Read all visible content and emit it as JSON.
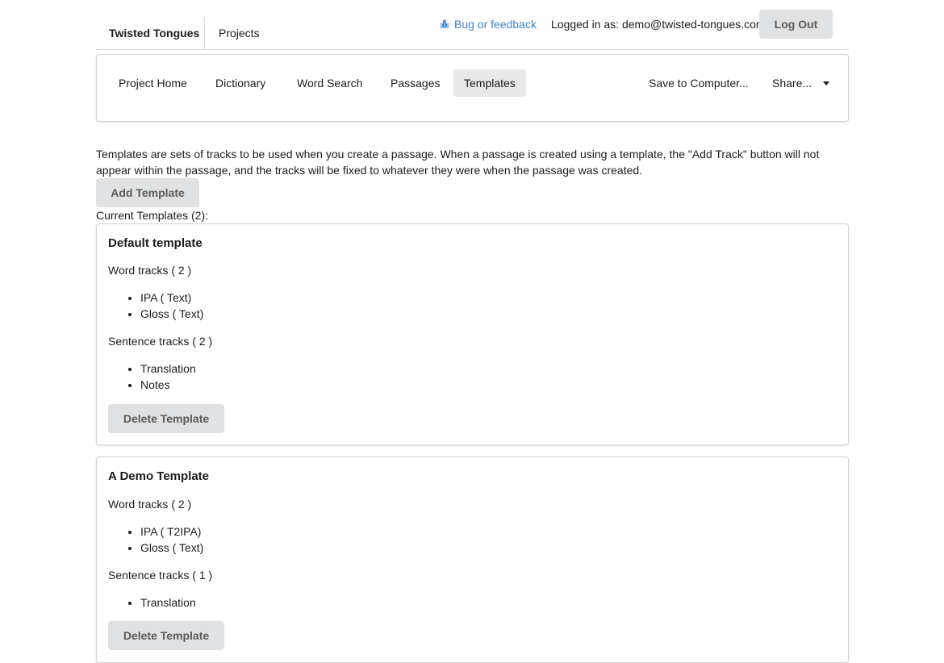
{
  "header": {
    "brand": "Twisted Tongues",
    "projects_label": "Projects",
    "bug_label": "Bug or feedback",
    "logged_in_text": "Logged in as: demo@twisted-tongues.com",
    "logout_label": "Log Out"
  },
  "menu": {
    "items": [
      {
        "label": "Project Home",
        "active": false
      },
      {
        "label": "Dictionary",
        "active": false
      },
      {
        "label": "Word Search",
        "active": false
      },
      {
        "label": "Passages",
        "active": false
      },
      {
        "label": "Templates",
        "active": true
      }
    ],
    "save_label": "Save to Computer...",
    "share_label": "Share..."
  },
  "content": {
    "description": "Templates are sets of tracks to be used when you create a passage. When a passage is created using a template, the \"Add Track\" button will not appear within the passage, and the tracks will be fixed to whatever they were when the passage was created.",
    "add_template_label": "Add Template",
    "current_templates_label": "Current Templates (2):"
  },
  "templates": [
    {
      "name": "Default template",
      "word_tracks_label": "Word tracks ( 2 )",
      "word_tracks": [
        "IPA ( Text)",
        "Gloss ( Text)"
      ],
      "sentence_tracks_label": "Sentence tracks ( 2 )",
      "sentence_tracks": [
        "Translation",
        "Notes"
      ],
      "delete_label": "Delete Template"
    },
    {
      "name": "A Demo Template",
      "word_tracks_label": "Word tracks ( 2 )",
      "word_tracks": [
        "IPA ( T2IPA)",
        "Gloss ( Text)"
      ],
      "sentence_tracks_label": "Sentence tracks ( 1 )",
      "sentence_tracks": [
        "Translation"
      ],
      "delete_label": "Delete Template"
    }
  ],
  "colors": {
    "link": "#4183c4",
    "button_bg": "#e0e1e2",
    "active_menu_bg": "#e8e8e8",
    "border": "#d4d4d5"
  },
  "icons": {
    "bug": "bug-icon",
    "share_caret": "caret-down-icon"
  }
}
